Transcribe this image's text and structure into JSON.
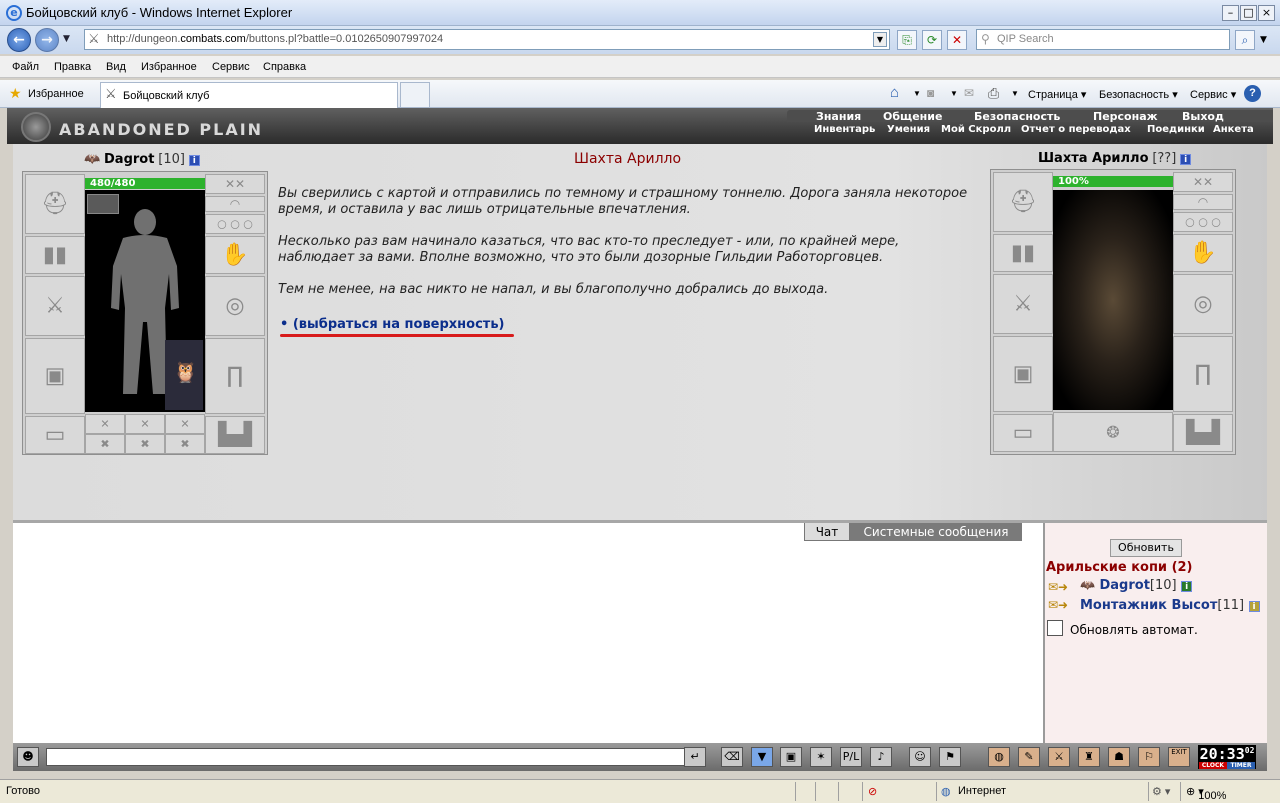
{
  "window": {
    "title": "Бойцовский клуб - Windows Internet Explorer"
  },
  "address": {
    "prefix": "http://dungeon.",
    "domain": "combats.com",
    "rest": "/buttons.pl?battle=0.0102650907997024"
  },
  "search": {
    "placeholder": "QIP Search"
  },
  "menu": [
    "Файл",
    "Правка",
    "Вид",
    "Избранное",
    "Сервис",
    "Справка"
  ],
  "favorites": {
    "label": "Избранное",
    "tab_title": "Бойцовский клуб"
  },
  "ie_commands": {
    "page": "Страница",
    "safety": "Безопасность",
    "tools": "Сервис",
    "help": "?"
  },
  "game": {
    "logo": "ABANDONED PLAIN",
    "nav_top": [
      "Знания",
      "Общение",
      "Безопасность",
      "Персонаж",
      "Выход"
    ],
    "nav_bottom": [
      "Инвентарь",
      "Умения",
      "Мой Скролл",
      "Отчет о переводах",
      "Поединки",
      "Анкета"
    ],
    "player": {
      "name": "Dagrot",
      "level": "[10]",
      "hp": "480/480"
    },
    "location": {
      "name": "Шахта Арилло",
      "level": "[??]",
      "hp": "100%"
    },
    "story": [
      "Вы сверились с картой и отправились по темному и страшному тоннелю. Дорога заняла некоторое время, и оставила у вас лишь отрицательные впечатления.",
      "Несколько раз вам начинало казаться, что вас кто-то преследует - или, по крайней мере, наблюдает за вами. Вполне возможно, что это были дозорные Гильдии Работорговцев.",
      "Тем не менее, на вас никто не напал, и вы благополучно добрались до выхода."
    ],
    "exit_link": "(выбраться на поверхность)"
  },
  "chat": {
    "tab_chat": "Чат",
    "tab_system": "Системные сообщения",
    "refresh": "Обновить",
    "room": "Арильские копи (2)",
    "users": [
      {
        "name": "Dagrot",
        "level": "[10]"
      },
      {
        "name": "Монтажник Высот",
        "level": "[11]"
      }
    ],
    "auto_refresh": "Обновлять автомат."
  },
  "clock": {
    "time": "20:33",
    "seconds": "02",
    "clock_label": "CLOCK",
    "timer_label": "TIMER",
    "exit_label": "EXIT"
  },
  "statusbar": {
    "left": "Готово",
    "zone": "Интернет",
    "zoom": "100%"
  }
}
